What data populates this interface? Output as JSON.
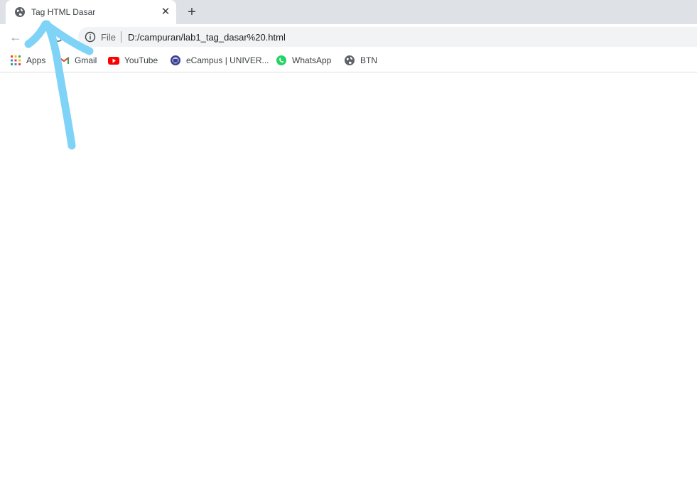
{
  "tab": {
    "title": "Tag HTML Dasar",
    "close_glyph": "✕",
    "favicon": "globe-icon"
  },
  "new_tab": {
    "glyph": "+"
  },
  "toolbar": {
    "back_glyph": "←",
    "omnibox": {
      "scheme_label": "File",
      "url": "D:/campuran/lab1_tag_dasar%20.html"
    }
  },
  "bookmarks": [
    {
      "label": "Apps",
      "icon": "apps-grid-icon"
    },
    {
      "label": "Gmail",
      "icon": "gmail-icon"
    },
    {
      "label": "YouTube",
      "icon": "youtube-icon"
    },
    {
      "label": "eCampus | UNIVER...",
      "icon": "ecampus-icon"
    },
    {
      "label": "WhatsApp",
      "icon": "whatsapp-icon"
    },
    {
      "label": "BTN",
      "icon": "globe-icon"
    }
  ],
  "colors": {
    "tabstrip": "#dee1e6",
    "omnibox": "#f1f3f4",
    "annotation_stroke": "#7fd3f7",
    "youtube": "#ff0000",
    "whatsapp": "#25d366"
  }
}
